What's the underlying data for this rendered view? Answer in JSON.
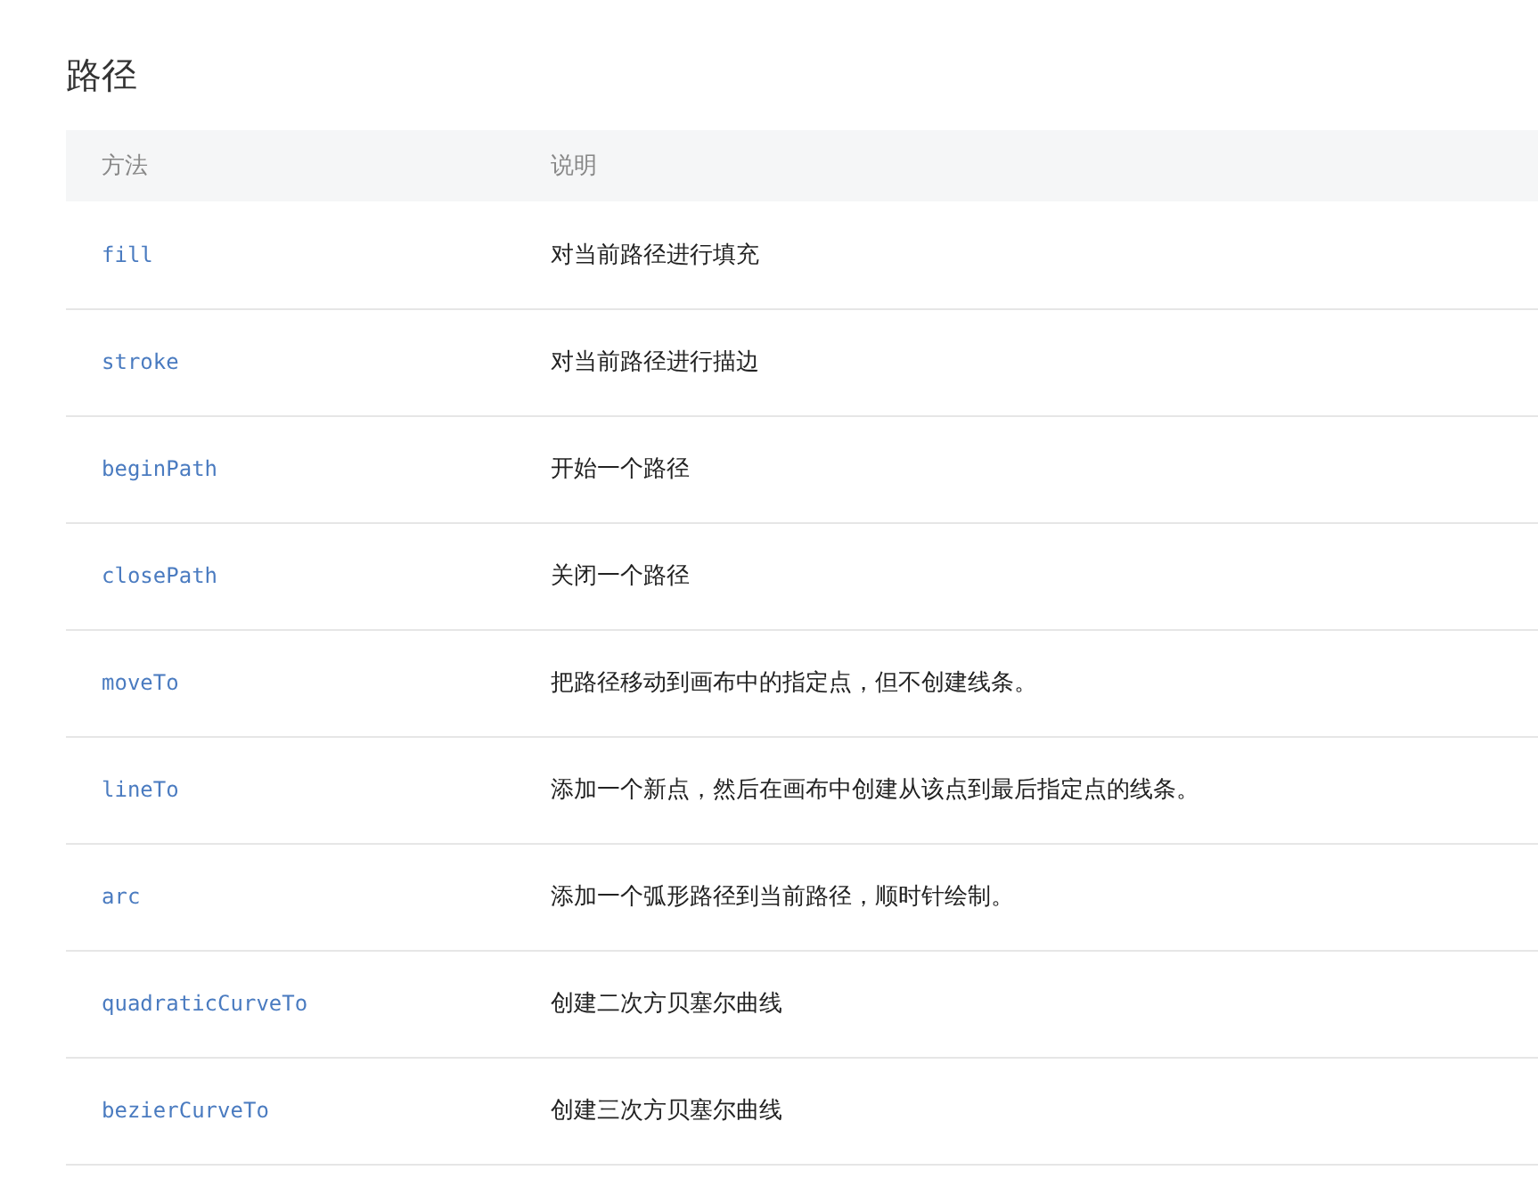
{
  "title": "路径",
  "table": {
    "columns": [
      "方法",
      "说明"
    ],
    "rows": [
      {
        "method": "fill",
        "description": "对当前路径进行填充"
      },
      {
        "method": "stroke",
        "description": "对当前路径进行描边"
      },
      {
        "method": "beginPath",
        "description": "开始一个路径"
      },
      {
        "method": "closePath",
        "description": "关闭一个路径"
      },
      {
        "method": "moveTo",
        "description": "把路径移动到画布中的指定点，但不创建线条。"
      },
      {
        "method": "lineTo",
        "description": "添加一个新点，然后在画布中创建从该点到最后指定点的线条。"
      },
      {
        "method": "arc",
        "description": "添加一个弧形路径到当前路径，顺时针绘制。"
      },
      {
        "method": "quadraticCurveTo",
        "description": "创建二次方贝塞尔曲线"
      },
      {
        "method": "bezierCurveTo",
        "description": "创建三次方贝塞尔曲线"
      }
    ]
  }
}
